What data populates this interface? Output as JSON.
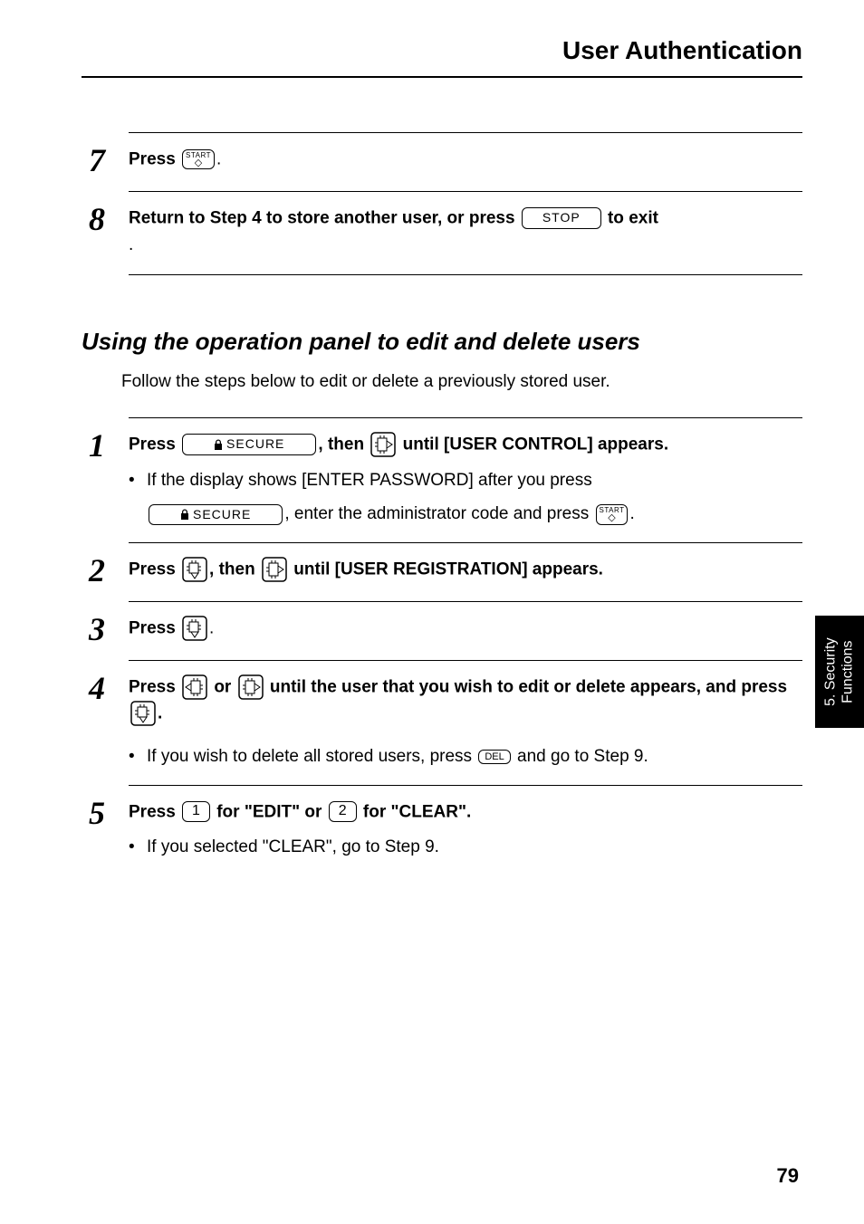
{
  "header": {
    "title": "User Authentication"
  },
  "block1": {
    "steps": [
      {
        "num": "7",
        "head_a": "Press ",
        "head_b": "."
      },
      {
        "num": "8",
        "head_a": "Return to Step 4 to store another user, or press ",
        "key": "STOP",
        "head_b": " to exit",
        "trailing": "."
      }
    ]
  },
  "section": {
    "subheading": "Using the operation panel to edit and delete users",
    "intro": "Follow the steps below to edit or delete a previously stored user."
  },
  "block2": {
    "steps": [
      {
        "num": "1",
        "a": "Press ",
        "secure": "SECURE",
        "b": ", then ",
        "c": " until [USER CONTROL] appears.",
        "bullet": "If the display shows [ENTER PASSWORD] after you press",
        "indent_b": ", enter the administrator code and press ",
        "indent_c": "."
      },
      {
        "num": "2",
        "a": "Press ",
        "b": ", then ",
        "c": " until [USER REGISTRATION] appears."
      },
      {
        "num": "3",
        "a": "Press ",
        "b": "."
      },
      {
        "num": "4",
        "a": "Press ",
        "or": " or ",
        "b": " until the user that you wish to edit or delete appears, and press ",
        "c": ".",
        "bullet_a": "If you wish to delete all stored users, press ",
        "del": "DEL",
        "bullet_b": " and go to Step 9."
      },
      {
        "num": "5",
        "a": "Press ",
        "k1": "1",
        "b": " for \"EDIT\" or ",
        "k2": "2",
        "c": " for  \"CLEAR\".",
        "bullet": "If you selected \"CLEAR\", go to Step 9."
      }
    ]
  },
  "keys": {
    "start": "START",
    "secure": "SECURE"
  },
  "sidetab": {
    "line1": "5. Security",
    "line2": "Functions"
  },
  "page_number": "79"
}
